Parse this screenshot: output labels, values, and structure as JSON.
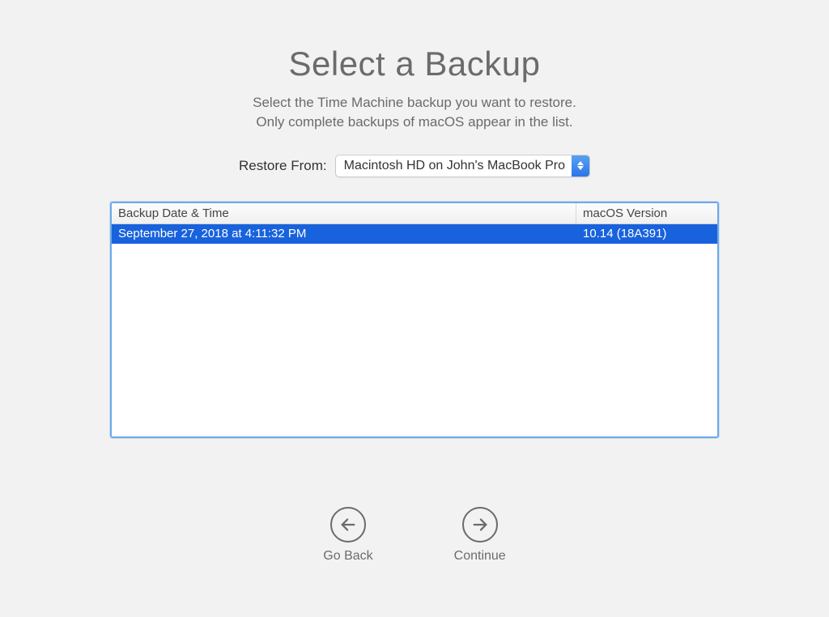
{
  "title": "Select a Backup",
  "subtitle_line1": "Select the Time Machine backup you want to restore.",
  "subtitle_line2": "Only complete backups of macOS appear in the list.",
  "restore": {
    "label": "Restore From:",
    "selected": "Macintosh HD on John's MacBook Pro"
  },
  "table": {
    "header_date": "Backup Date & Time",
    "header_version": "macOS Version",
    "rows": [
      {
        "date": "September 27, 2018 at 4:11:32 PM",
        "version": "10.14 (18A391)",
        "selected": true
      }
    ]
  },
  "buttons": {
    "back": "Go Back",
    "continue": "Continue"
  }
}
